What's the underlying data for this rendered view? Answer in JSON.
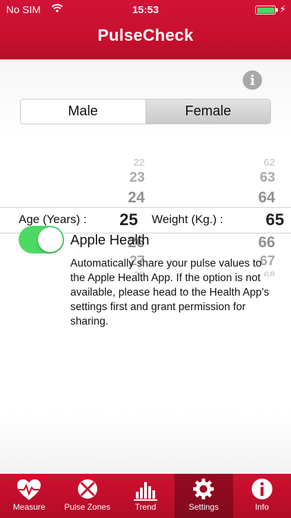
{
  "status_bar": {
    "carrier": "No SIM",
    "time": "15:53",
    "charging_symbol": "⚡"
  },
  "app_title": "PulseCheck",
  "info_icon_glyph": "i",
  "gender": {
    "options": [
      "Male",
      "Female"
    ],
    "selected": "Female"
  },
  "age": {
    "label": "Age (Years) :",
    "above": [
      "22",
      "23",
      "24"
    ],
    "value": "25",
    "below": [
      "26",
      "27",
      "28"
    ]
  },
  "weight": {
    "label": "Weight (Kg.) :",
    "above": [
      "62",
      "63",
      "64"
    ],
    "value": "65",
    "below": [
      "66",
      "67",
      "68"
    ]
  },
  "apple_health": {
    "label": "Apple Health",
    "enabled": true,
    "description": "Automatically share your pulse values to the Apple Health App. If the option is not available, please head to the Health App's settings first and grant permission for sharing."
  },
  "colors": {
    "brand_red": "#c8102e",
    "toggle_green": "#4cd964"
  },
  "tabs": [
    {
      "label": "Measure",
      "icon": "heart-pulse-icon"
    },
    {
      "label": "Pulse Zones",
      "icon": "zones-icon"
    },
    {
      "label": "Trend",
      "icon": "bar-chart-icon"
    },
    {
      "label": "Settings",
      "icon": "gear-icon",
      "active": true
    },
    {
      "label": "Info",
      "icon": "info-icon"
    }
  ]
}
